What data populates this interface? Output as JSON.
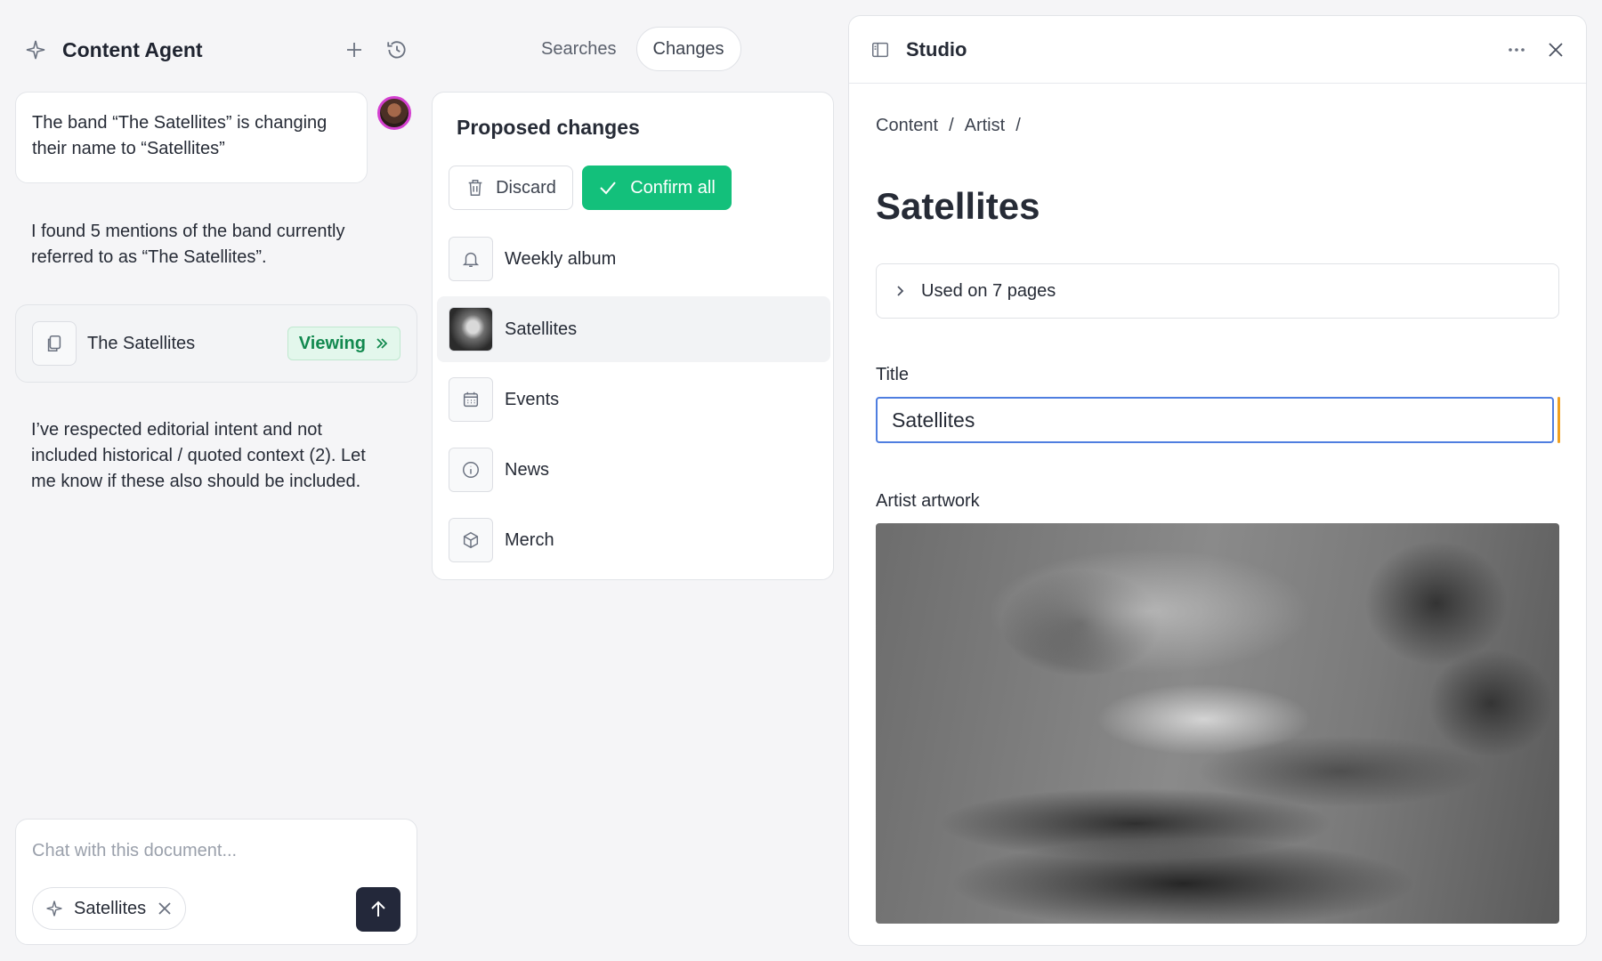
{
  "agent": {
    "title": "Content Agent",
    "user_message": "The band “The Satellites” is changing their name to “Satellites”",
    "reply_1": "I found 5 mentions of the band currently referred to as “The Satellites”.",
    "doc_card": {
      "name": "The Satellites",
      "badge": "Viewing"
    },
    "reply_2": "I’ve respected editorial intent and not included historical / quoted context (2). Let me know if these also should be included.",
    "chat": {
      "placeholder": "Chat with this document...",
      "chip": "Satellites"
    }
  },
  "tabs": {
    "searches": "Searches",
    "changes": "Changes",
    "active": "Changes"
  },
  "changes": {
    "heading": "Proposed changes",
    "discard_label": "Discard",
    "confirm_label": "Confirm all",
    "items": [
      {
        "label": "Weekly album",
        "icon": "bell-icon"
      },
      {
        "label": "Satellites",
        "icon": "thumbnail",
        "selected": true
      },
      {
        "label": "Events",
        "icon": "calendar-icon"
      },
      {
        "label": "News",
        "icon": "info-icon"
      },
      {
        "label": "Merch",
        "icon": "box-icon"
      }
    ]
  },
  "studio": {
    "title": "Studio",
    "breadcrumb": [
      "Content",
      "/",
      "Artist",
      "/"
    ],
    "doc_title": "Satellites",
    "used_on": "Used on 7 pages",
    "title_label": "Title",
    "title_value": "Satellites",
    "artwork_label": "Artist artwork"
  },
  "colors": {
    "confirm": "#13c07b",
    "viewing": "#12894f",
    "focus": "#4f7ee0",
    "send": "#23283a"
  }
}
